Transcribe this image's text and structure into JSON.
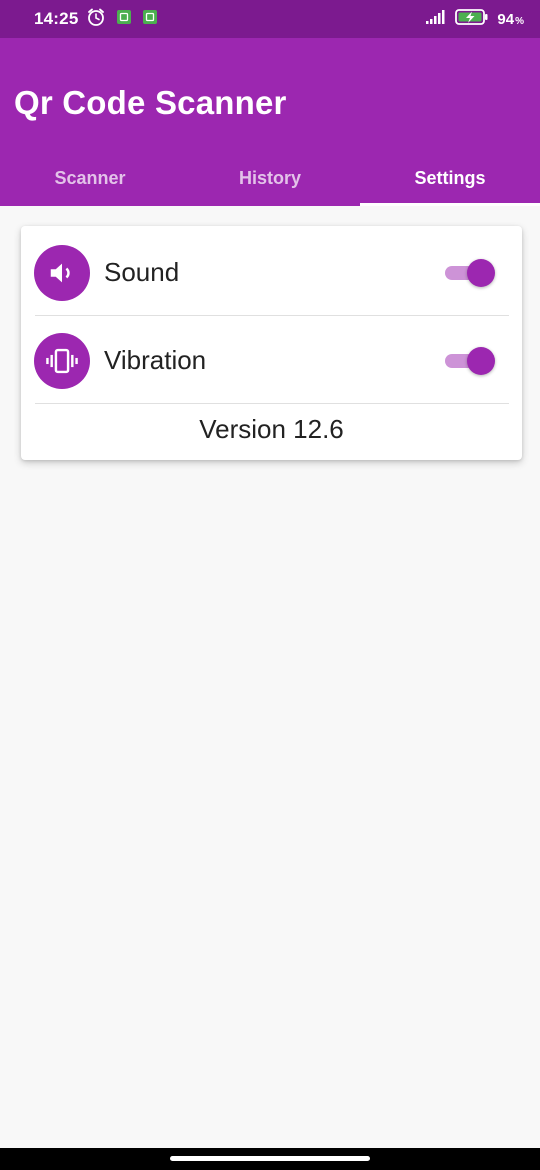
{
  "status_bar": {
    "time": "14:25",
    "battery_level": "94",
    "battery_unit": "%",
    "icons": [
      "alarm-icon",
      "notification-app-icon",
      "notification-app-icon",
      "signal-icon",
      "battery-charging-icon"
    ]
  },
  "app": {
    "title": "Qr Code Scanner"
  },
  "tabs": [
    {
      "label": "Scanner",
      "active": false
    },
    {
      "label": "History",
      "active": false
    },
    {
      "label": "Settings",
      "active": true
    }
  ],
  "settings": {
    "sound": {
      "label": "Sound",
      "icon": "volume-icon",
      "enabled": true
    },
    "vibration": {
      "label": "Vibration",
      "icon": "vibration-icon",
      "enabled": true
    },
    "version": "Version 12.6"
  },
  "colors": {
    "status_bar": "#7c1a8f",
    "primary": "#9c27b0",
    "switch_track": "#cd93d7",
    "background": "#f8f8f8"
  }
}
